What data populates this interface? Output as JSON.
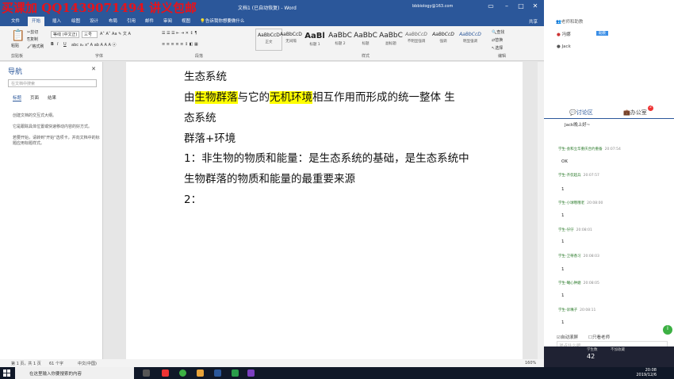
{
  "watermark": "买课加 QQ1439071494 讲义包邮",
  "window": {
    "title": "文档1 (已自动恢复) - Word",
    "user": "bbbiology@163.com"
  },
  "tabs": [
    "文件",
    "开始",
    "插入",
    "绘图",
    "设计",
    "布局",
    "引用",
    "邮件",
    "审阅",
    "视图"
  ],
  "active_tab": "开始",
  "tellme": "告诉我你想要做什么",
  "share": "共享",
  "ribbon": {
    "paste": "粘贴",
    "cut": "剪切",
    "copy": "复制",
    "format_painter": "格式刷",
    "font_name": "等线 (中文正)",
    "font_size": "三号",
    "groups": [
      "剪贴板",
      "字体",
      "段落",
      "样式",
      "编辑"
    ],
    "styles": [
      {
        "preview": "AaBbCcD",
        "name": "正文"
      },
      {
        "preview": "AaBbCcD",
        "name": "无间隔"
      },
      {
        "preview": "AaBl",
        "name": "标题 1"
      },
      {
        "preview": "AaBbC",
        "name": "标题 2"
      },
      {
        "preview": "AaBbC",
        "name": "标题"
      },
      {
        "preview": "AaBbC",
        "name": "副标题"
      },
      {
        "preview": "AaBbCcD",
        "name": "不明显强调"
      },
      {
        "preview": "AaBbCcD",
        "name": "强调"
      },
      {
        "preview": "AaBbCcD",
        "name": "明显强调"
      }
    ],
    "find": "查找",
    "replace": "替换",
    "select": "选择"
  },
  "nav": {
    "title": "导航",
    "search_placeholder": "在文档中搜索",
    "tabs": [
      "标题",
      "页面",
      "结果"
    ],
    "hint1": "创建文档的交互式大纲。",
    "hint2": "它是跟踪具体位置或快速移动内容的好方式。",
    "hint3": "若要开始，请转到\"开始\"选项卡，并向文档中的标题应用标题样式。"
  },
  "document": {
    "lines": [
      {
        "text": "生态系统"
      },
      {
        "pre": "由",
        "hl1": "生物群落",
        "mid": "与它的",
        "hl2": "无机环境",
        "post": "相互作用而形成的统一整体 生"
      },
      {
        "text": "态系统"
      },
      {
        "text": "群落+环境"
      },
      {
        "text": "1：非生物的物质和能量：是生态系统的基础，是生态系统中"
      },
      {
        "text": "生物群落的物质和能量的最重要来源"
      },
      {
        "text": "2："
      }
    ]
  },
  "statusbar": {
    "page": "第 1 页，共 1 页",
    "words": "61 个字",
    "lang": "中文(中国)",
    "zoom": "160%"
  },
  "panel": {
    "teacher_label": "老师和助教",
    "teacher": "冯娜",
    "badge": "助教",
    "assistant": "Jack",
    "tab_discuss": "讨论区",
    "tab_office": "办公室",
    "office_badge": "2",
    "jack_msg": "Jack晚上好~",
    "messages": [
      {
        "name": "学生-会和立华重庆合约重备",
        "time": "20:07:54",
        "text": "OK"
      },
      {
        "name": "学生-齐侃超兵",
        "time": "20:07:57",
        "text": "1"
      },
      {
        "name": "学生-小球哦哦老",
        "time": "20:08:00",
        "text": "1"
      },
      {
        "name": "学生-仔仔",
        "time": "20:08:01",
        "text": "1"
      },
      {
        "name": "学生-卫蒂香习",
        "time": "20:08:03",
        "text": "1"
      },
      {
        "name": "学生-曦心钟磨",
        "time": "20:08:05",
        "text": "1"
      },
      {
        "name": "学生-诉嘴子",
        "time": "20:08:11",
        "text": "1"
      }
    ],
    "auto_scroll": "自动滚屏",
    "only_teacher": "只看老师",
    "input_placeholder": "说点什么吧",
    "students_label": "学生数",
    "students": "42",
    "fav_label": "不加收藏"
  },
  "taskbar": {
    "search": "在这里输入你要搜索的内容",
    "time": "20:08",
    "date": "2019/12/6"
  }
}
